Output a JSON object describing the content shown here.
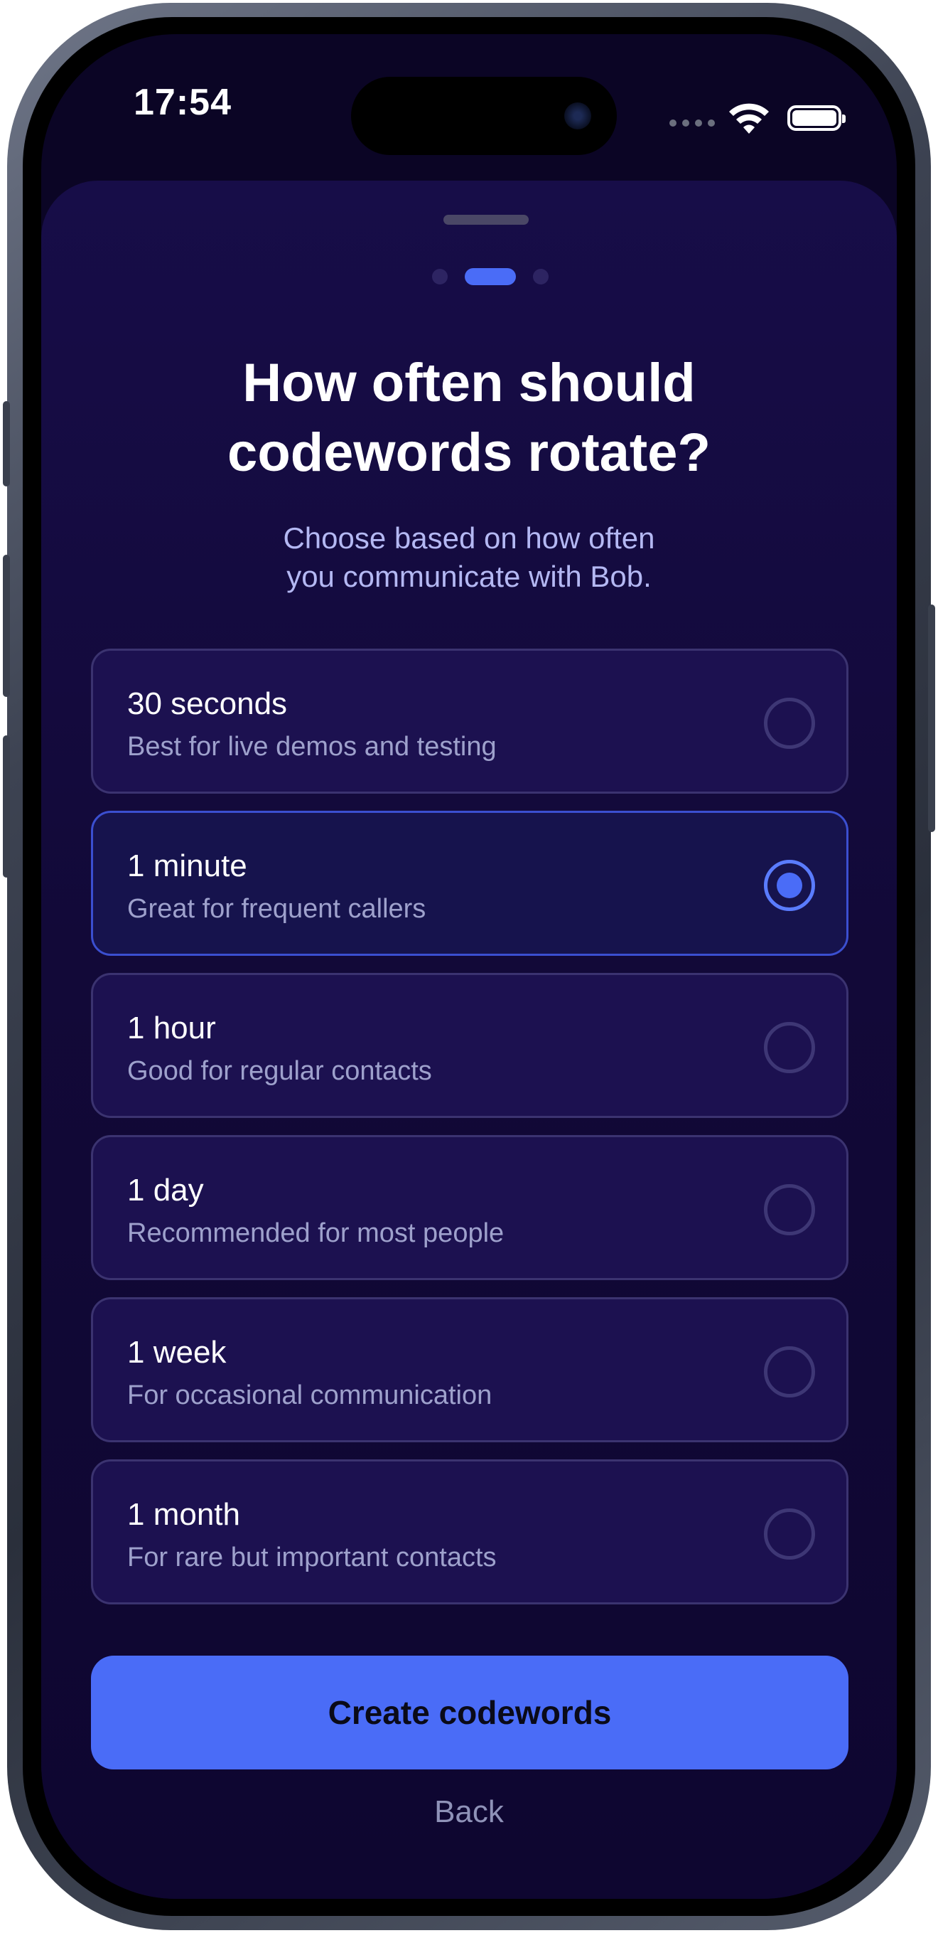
{
  "status_bar": {
    "time": "17:54"
  },
  "pager": {
    "total": 3,
    "active_index": 1
  },
  "header": {
    "title_line1": "How often should",
    "title_line2": "codewords rotate?",
    "subtitle_line1": "Choose based on how often",
    "subtitle_line2": "you communicate with Bob."
  },
  "options": [
    {
      "label": "30 seconds",
      "description": "Best for live demos and testing",
      "selected": false
    },
    {
      "label": "1 minute",
      "description": "Great for frequent callers",
      "selected": true
    },
    {
      "label": "1 hour",
      "description": "Good for regular contacts",
      "selected": false
    },
    {
      "label": "1 day",
      "description": "Recommended for most people",
      "selected": false
    },
    {
      "label": "1 week",
      "description": "For occasional communication",
      "selected": false
    },
    {
      "label": "1 month",
      "description": "For rare but important contacts",
      "selected": false
    }
  ],
  "actions": {
    "primary_label": "Create codewords",
    "back_label": "Back"
  },
  "colors": {
    "accent": "#4a6cf7",
    "background": "#0e0630",
    "card": "#1c1150"
  }
}
